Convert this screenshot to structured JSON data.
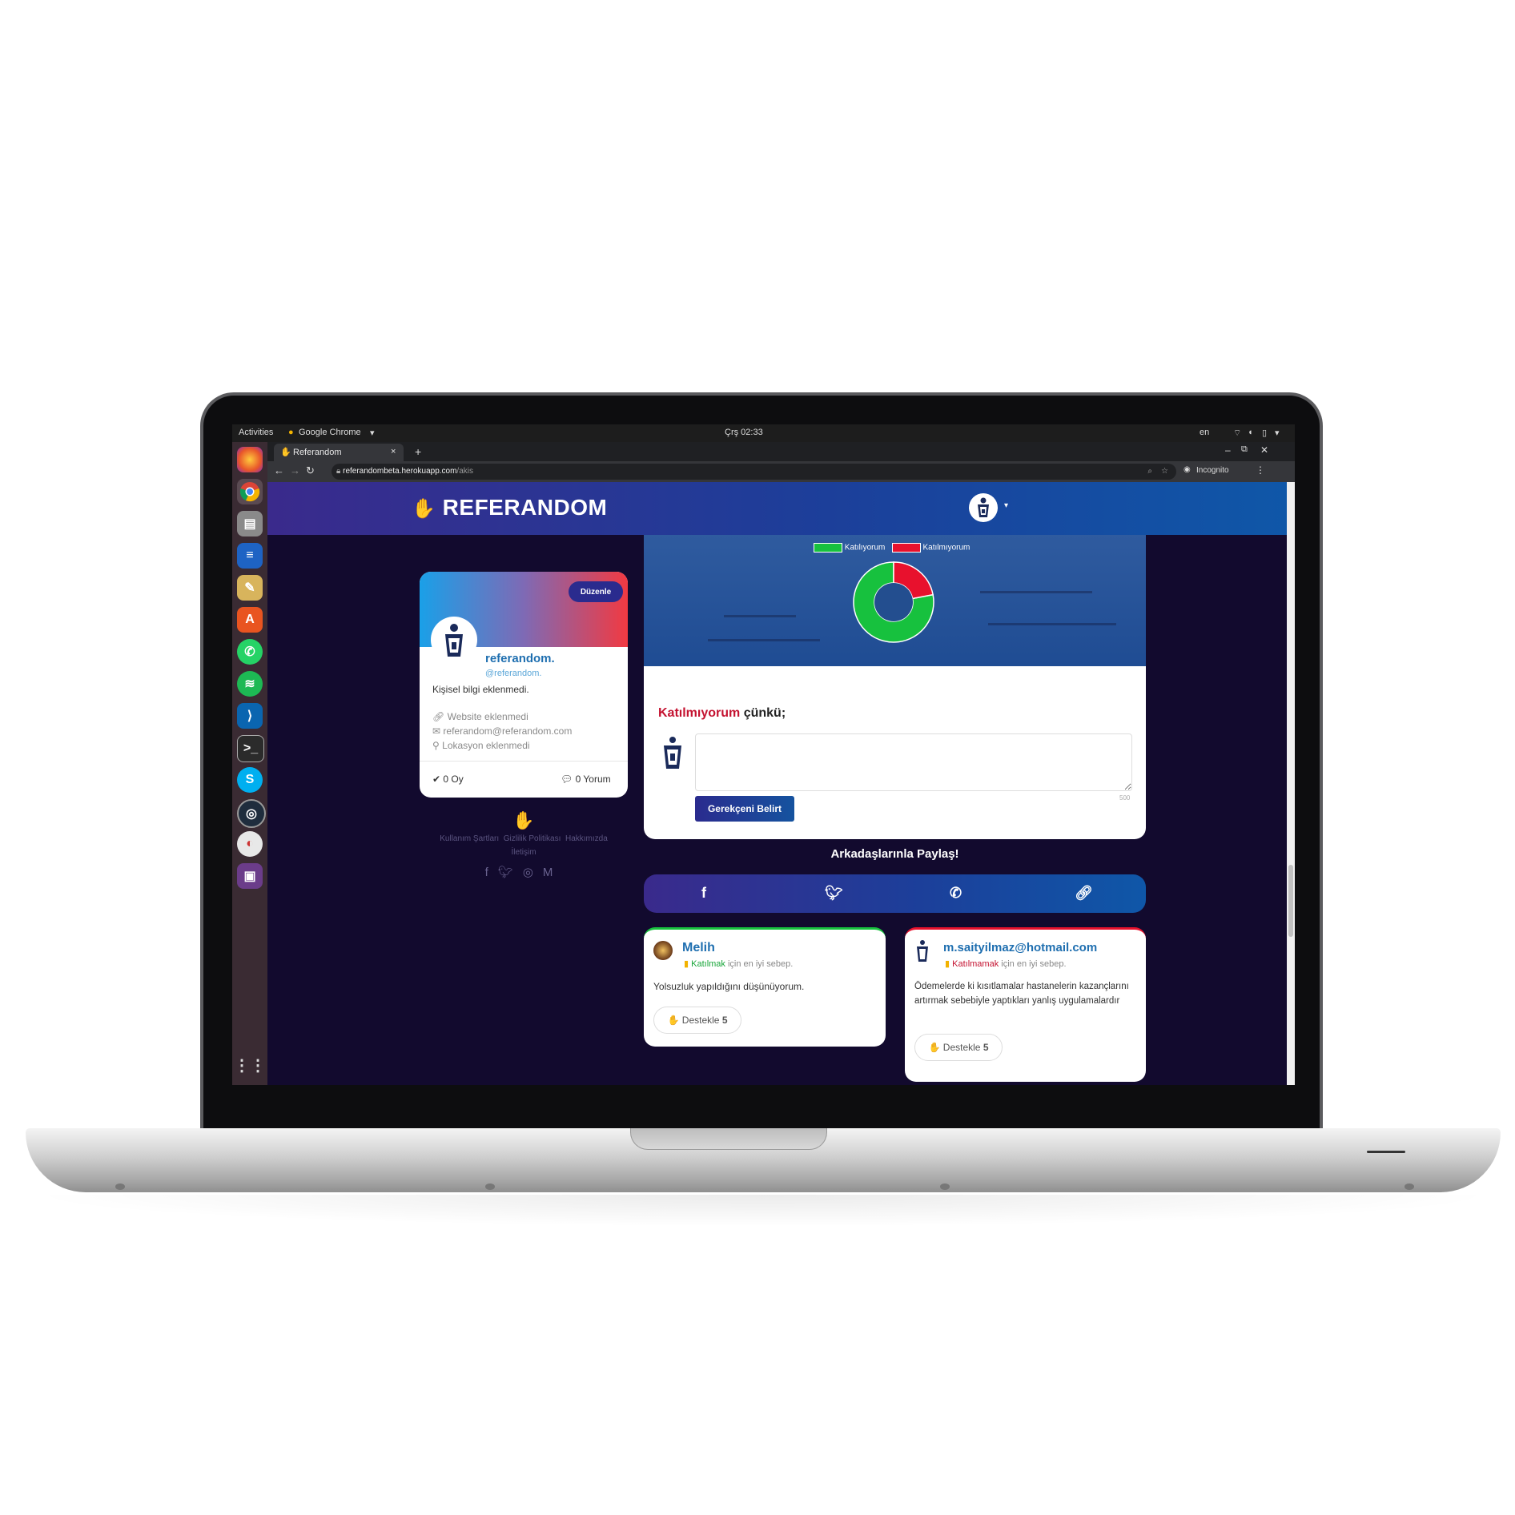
{
  "system": {
    "activities": "Activities",
    "app_name": "Google Chrome",
    "clock": "Çrş 02:33",
    "lang": "en"
  },
  "browser": {
    "tab_title": "Referandom",
    "url_host": "referandombeta.herokuapp.com",
    "url_path": "/akis",
    "incognito": "Incognito"
  },
  "site": {
    "brand": "REFERANDOM"
  },
  "profile": {
    "edit_label": "Düzenle",
    "name": "referandom.",
    "handle": "@referandom.",
    "bio": "Kişisel bilgi eklenmedi.",
    "website": "Website eklenmedi",
    "email": "referandom@referandom.com",
    "location": "Lokasyon eklenmedi",
    "votes": "0 Oy",
    "comments": "0 Yorum"
  },
  "footer": {
    "terms": "Kullanım Şartları",
    "privacy": "Gizlilik Politikası",
    "about": "Hakkımızda",
    "contact": "İletişim"
  },
  "poll": {
    "legend_agree": "Katılıyorum",
    "legend_disagree": "Katılmıyorum",
    "agree_color": "#17c13e",
    "disagree_color": "#e8112d",
    "agree_share": 0.78,
    "disagree_share": 0.22
  },
  "reason": {
    "choice": "Katılmıyorum",
    "suffix": " çünkü;",
    "char_limit": "500",
    "submit_label": "Gerekçeni Belirt"
  },
  "share": {
    "title": "Arkadaşlarınla Paylaş!"
  },
  "comments": [
    {
      "author": "Melih",
      "stance": "Katılmak",
      "stance_suffix": " için en iyi sebep.",
      "text": "Yolsuzluk yapıldığını düşünüyorum.",
      "support_label": "Destekle",
      "support_count": "5",
      "accent": "#17c13e"
    },
    {
      "author": "m.saityilmaz@hotmail.com",
      "stance": "Katılmamak",
      "stance_suffix": " için en iyi sebep.",
      "text": "Ödemelerde ki kısıtlamalar hastanelerin kazançlarını artırmak sebebiyle yaptıkları yanlış uygulamalardır",
      "support_label": "Destekle",
      "support_count": "5",
      "accent": "#e8112d"
    }
  ]
}
